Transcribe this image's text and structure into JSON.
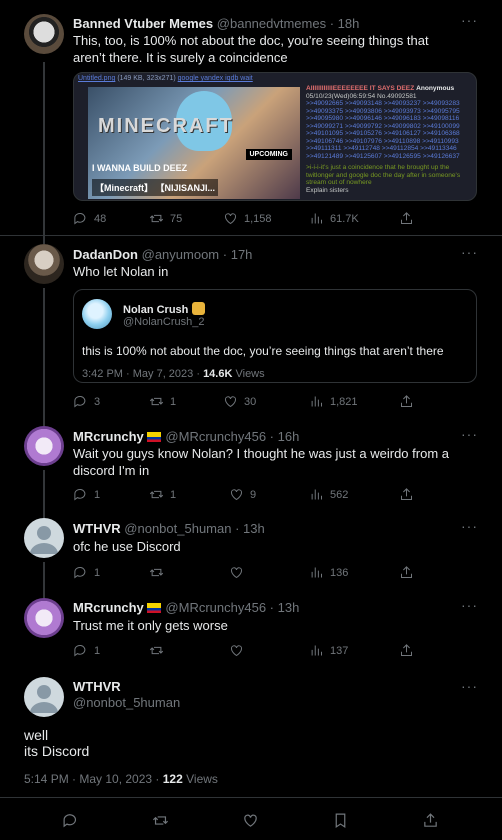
{
  "tweets": [
    {
      "name": "Banned Vtuber Memes",
      "handle": "@bannedvtmemes",
      "time": "18h",
      "text": "This, too, is 100% not about the doc, you’re seeing things that aren’t there. It is surely a coincidence",
      "replies": "48",
      "retweets": "75",
      "likes": "1,158",
      "views": "61.7K"
    },
    {
      "name": "DadanDon",
      "handle": "@anyumoom",
      "time": "17h",
      "text": "Who let Nolan in",
      "replies": "3",
      "retweets": "1",
      "likes": "30",
      "views": "1,821"
    },
    {
      "name": "MRcrunchy",
      "handle": "@MRcrunchy456",
      "time": "16h",
      "text": "Wait you guys know Nolan? I thought he was just a weirdo from a discord I'm in",
      "replies": "1",
      "retweets": "1",
      "likes": "9",
      "views": "562"
    },
    {
      "name": "WTHVR",
      "handle": "@nonbot_5human",
      "time": "13h",
      "text": "ofc he use Discord",
      "replies": "1",
      "retweets": "",
      "likes": "",
      "views": "136"
    },
    {
      "name": "MRcrunchy",
      "handle": "@MRcrunchy456",
      "time": "13h",
      "text": "Trust me it only gets worse",
      "replies": "1",
      "retweets": "",
      "likes": "",
      "views": "137"
    }
  ],
  "card": {
    "file_line": "Untitled.png",
    "file_info": "(149 KB, 323x271)",
    "links": "google yandex iqdb wait",
    "thumb_brand": "MINECRAFT",
    "thumb_badge": "UPCOMING",
    "thumb_line1": "I WANNA BUILD DEEZ",
    "thumb_line2": "【Minecraft】 【NIJISANJI...",
    "post_title": "AIIIIIIIIIIIIEEEEEEEE IT SAYS DEEZ",
    "post_author": "Anonymous",
    "post_date": "05/10/23(Wed)06:59:54 No.49092581",
    "post_refs": ">>49092665 >>49093148 >>49093237 >>49093283 >>49093375 >>49093806 >>49093973 >>49095795 >>49095980 >>49096146 >>49096183 >>49098116 >>49099271 >>49099792 >>49099802 >>49100099 >>49101095 >>49105276 >>49106127 >>49106368 >>49106746 >>49107976 >>49110898 >>49110993 >>49111311 >>49112748 >>49112854 >>49113346 >>49121489 >>49125607 >>49126595 >>49126637",
    "post_green": ">i-i-i-it's just a coincidence that he brought up the twitlonger and google doc the day after in someone's stream out of nowhere",
    "post_tail": "Explain sisters"
  },
  "quote": {
    "name": "Nolan Crush",
    "handle": "@NolanCrush_2",
    "text": "this is 100% not about the doc, you’re seeing things that aren’t there",
    "time": "3:42 PM · May 7, 2023 ·",
    "views": "14.6K",
    "views_label": "Views"
  },
  "main": {
    "name": "WTHVR",
    "handle": "@nonbot_5human",
    "line1": "well",
    "line2": "its Discord",
    "time": "5:14 PM · May 10, 2023 ·",
    "views": "122",
    "views_label": "Views"
  },
  "more_label": "···"
}
